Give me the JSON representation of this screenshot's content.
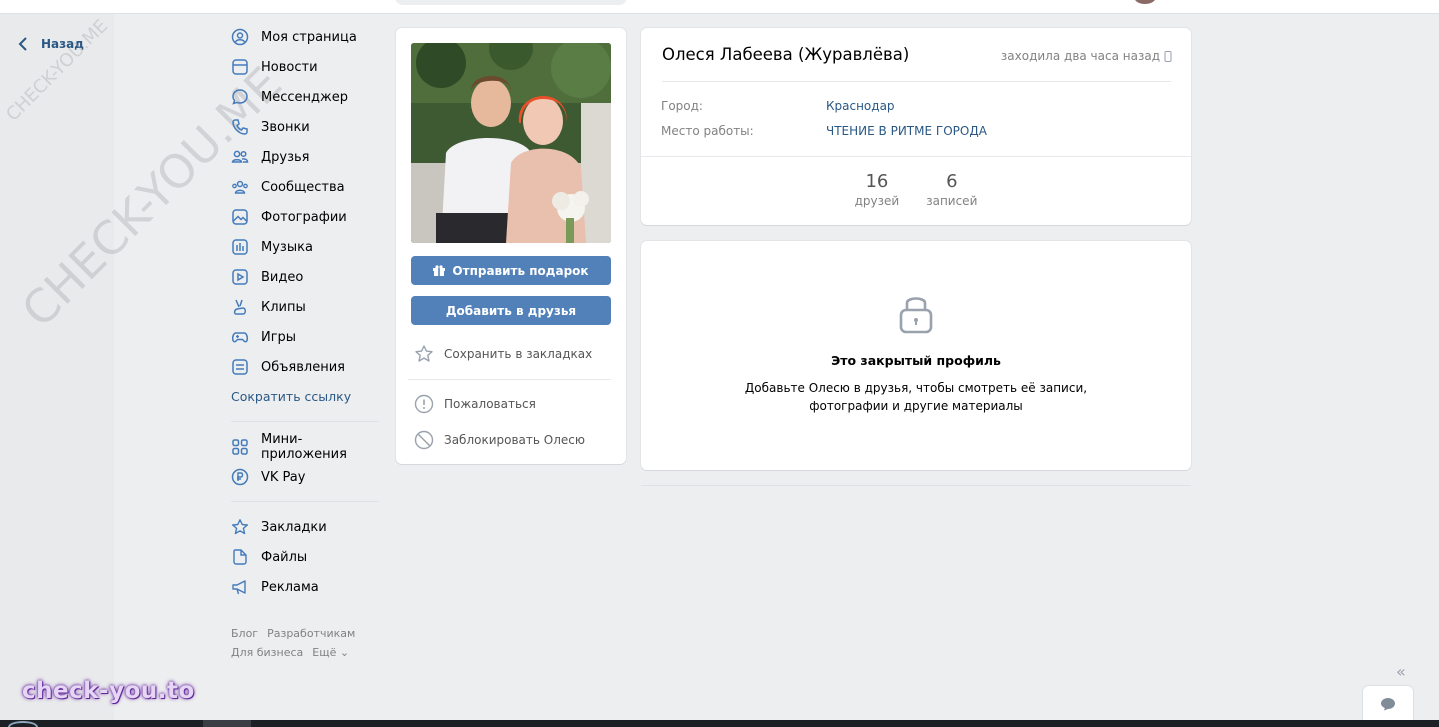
{
  "back": {
    "label": "Назад"
  },
  "watermark": {
    "text": "CHECK-YOU.ME"
  },
  "nav": {
    "items": [
      {
        "label": "Моя страница",
        "icon": "user-circle-icon"
      },
      {
        "label": "Новости",
        "icon": "news-icon"
      },
      {
        "label": "Мессенджер",
        "icon": "message-icon"
      },
      {
        "label": "Звонки",
        "icon": "phone-icon"
      },
      {
        "label": "Друзья",
        "icon": "friends-icon"
      },
      {
        "label": "Сообщества",
        "icon": "communities-icon"
      },
      {
        "label": "Фотографии",
        "icon": "photos-icon"
      },
      {
        "label": "Музыка",
        "icon": "music-icon"
      },
      {
        "label": "Видео",
        "icon": "video-icon"
      },
      {
        "label": "Клипы",
        "icon": "clips-icon"
      },
      {
        "label": "Игры",
        "icon": "games-icon"
      },
      {
        "label": "Объявления",
        "icon": "classifieds-icon"
      }
    ],
    "shorten_link": "Сократить ссылку",
    "items2": [
      {
        "label": "Мини-приложения",
        "icon": "mini-apps-icon"
      },
      {
        "label": "VK Pay",
        "icon": "vk-pay-icon"
      }
    ],
    "items3": [
      {
        "label": "Закладки",
        "icon": "star-icon"
      },
      {
        "label": "Файлы",
        "icon": "file-icon"
      },
      {
        "label": "Реклама",
        "icon": "megaphone-icon"
      }
    ]
  },
  "footer": {
    "blog": "Блог",
    "developers": "Разработчикам",
    "business": "Для бизнеса",
    "more": "Ещё ⌄"
  },
  "profile": {
    "send_gift": "Отправить подарок",
    "add_friend": "Добавить в друзья",
    "bookmark": "Сохранить в закладках",
    "report": "Пожаловаться",
    "block": "Заблокировать Олесю",
    "name": "Олеся Лабеева (Журавлёва)",
    "online": "заходила два часа назад",
    "city_label": "Город:",
    "city": "Краснодар",
    "work_label": "Место работы:",
    "work": "ЧТЕНИЕ В РИТМЕ ГОРОДА",
    "counters": [
      {
        "num": "16",
        "label": "друзей"
      },
      {
        "num": "6",
        "label": "записей"
      }
    ],
    "closed_title": "Это закрытый профиль",
    "closed_text": "Добавьте Олесю в друзья, чтобы смотреть её записи, фотографии и другие материалы"
  },
  "brand": "check-you.to",
  "colors": {
    "accent": "#5181b8",
    "link": "#2a5885",
    "background": "#edeef0"
  }
}
